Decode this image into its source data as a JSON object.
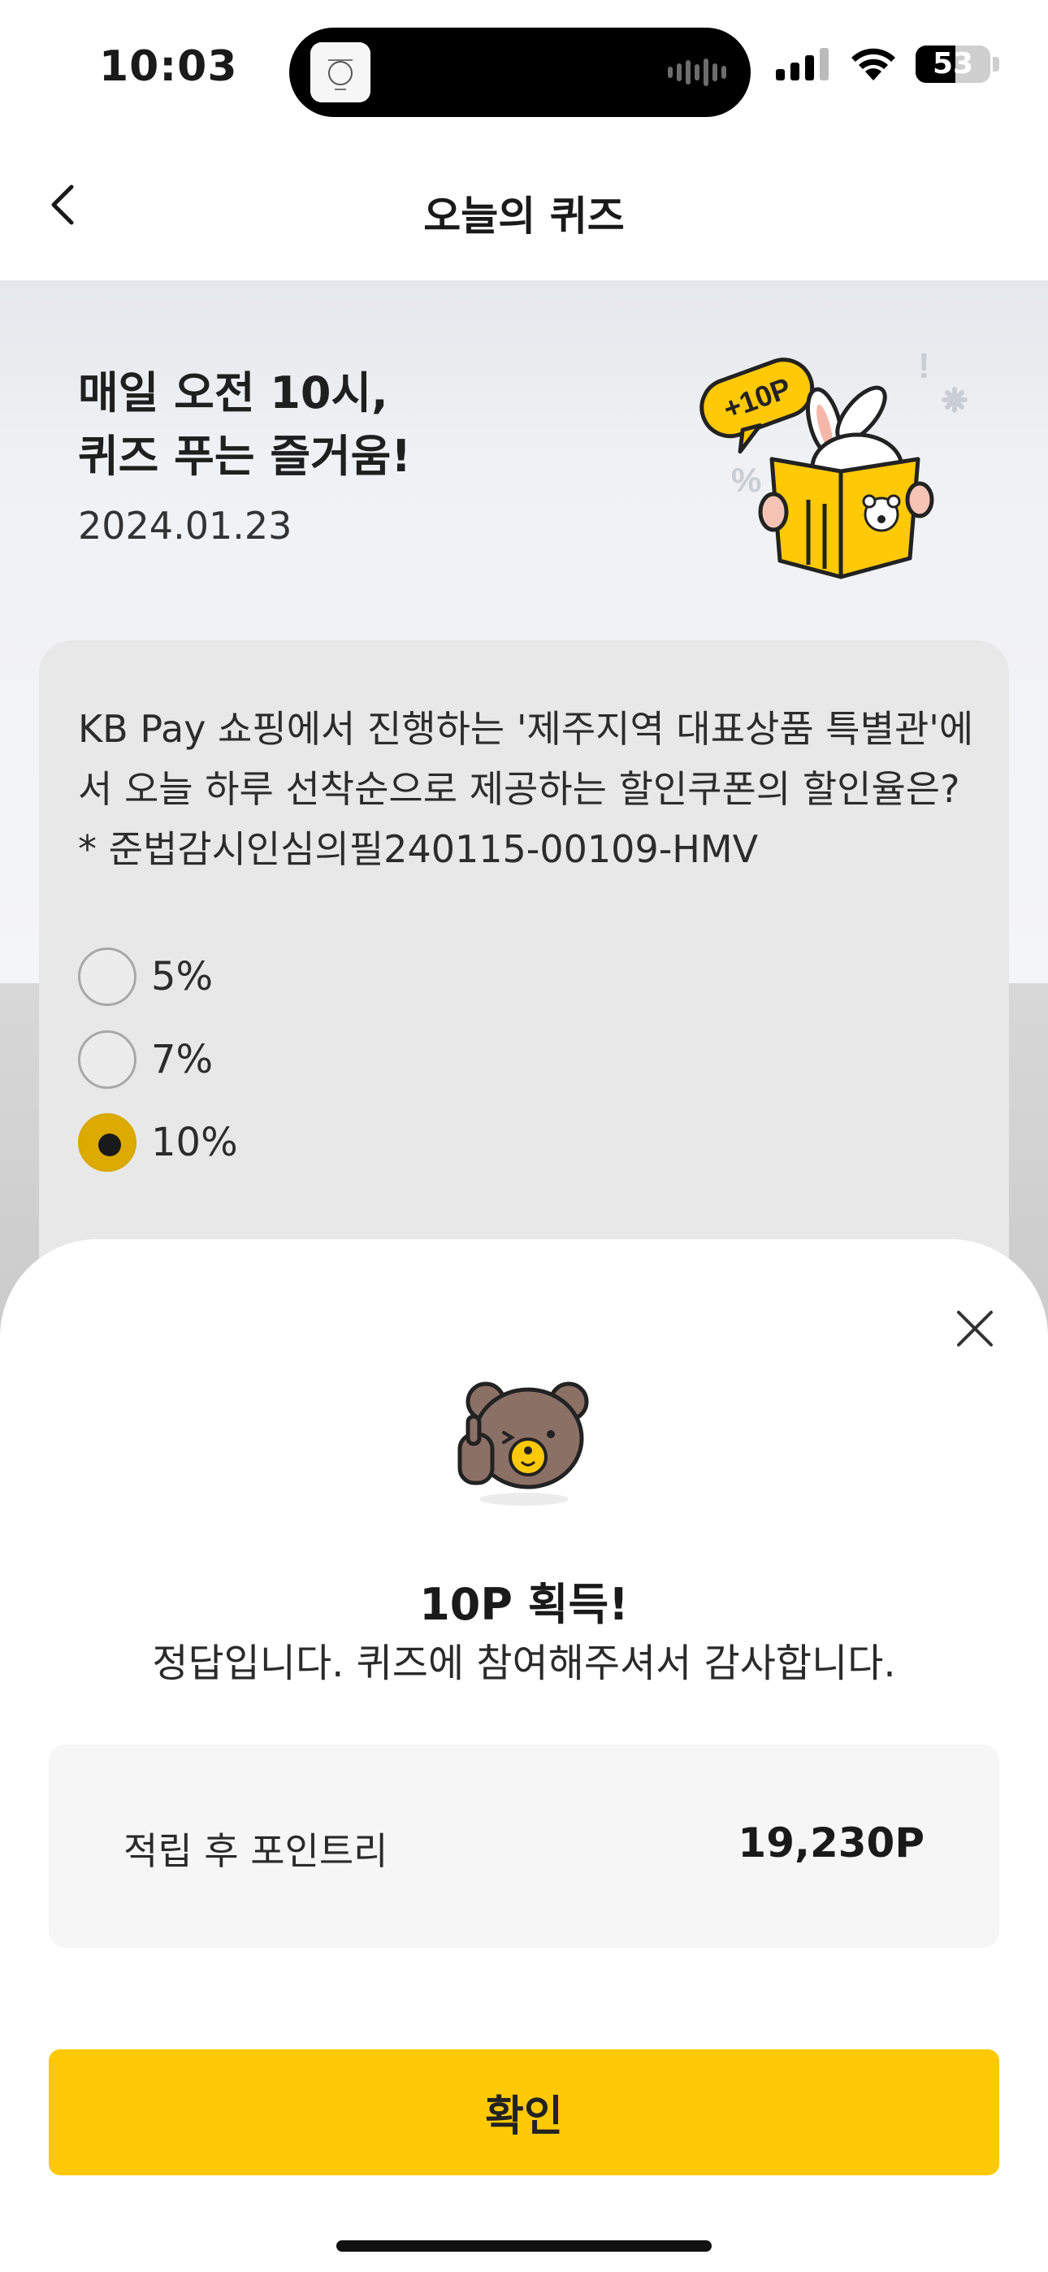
{
  "status_bar": {
    "time": "10:03",
    "battery_percent": 53,
    "battery_label": "53",
    "icons": [
      "signal-icon",
      "wifi-icon",
      "battery-icon"
    ]
  },
  "header": {
    "title": "오늘의 퀴즈",
    "back_icon": "chevron-left-icon"
  },
  "hero": {
    "title": "매일 오전 10시,\n퀴즈 푸는 즐거움!",
    "date": "2024.01.23",
    "badge": "+10P"
  },
  "quiz": {
    "question": "KB Pay 쇼핑에서 진행하는 '제주지역 대표상품 특별관'에서 오늘 하루 선착순으로 제공하는 할인쿠폰의 할인율은? * 준법감시인심의필240115-00109-HMV",
    "options": [
      {
        "label": "5%",
        "selected": false
      },
      {
        "label": "7%",
        "selected": false
      },
      {
        "label": "10%",
        "selected": true
      }
    ]
  },
  "result_sheet": {
    "title": "10P 획득!",
    "description": "정답입니다. 퀴즈에 참여해주셔서 감사합니다.",
    "points_label": "적립 후 포인트리",
    "points_value": "19,230P",
    "confirm_label": "확인",
    "close_icon": "close-icon"
  },
  "colors": {
    "accent": "#ffc905",
    "selected_radio": "#dcaa00"
  }
}
